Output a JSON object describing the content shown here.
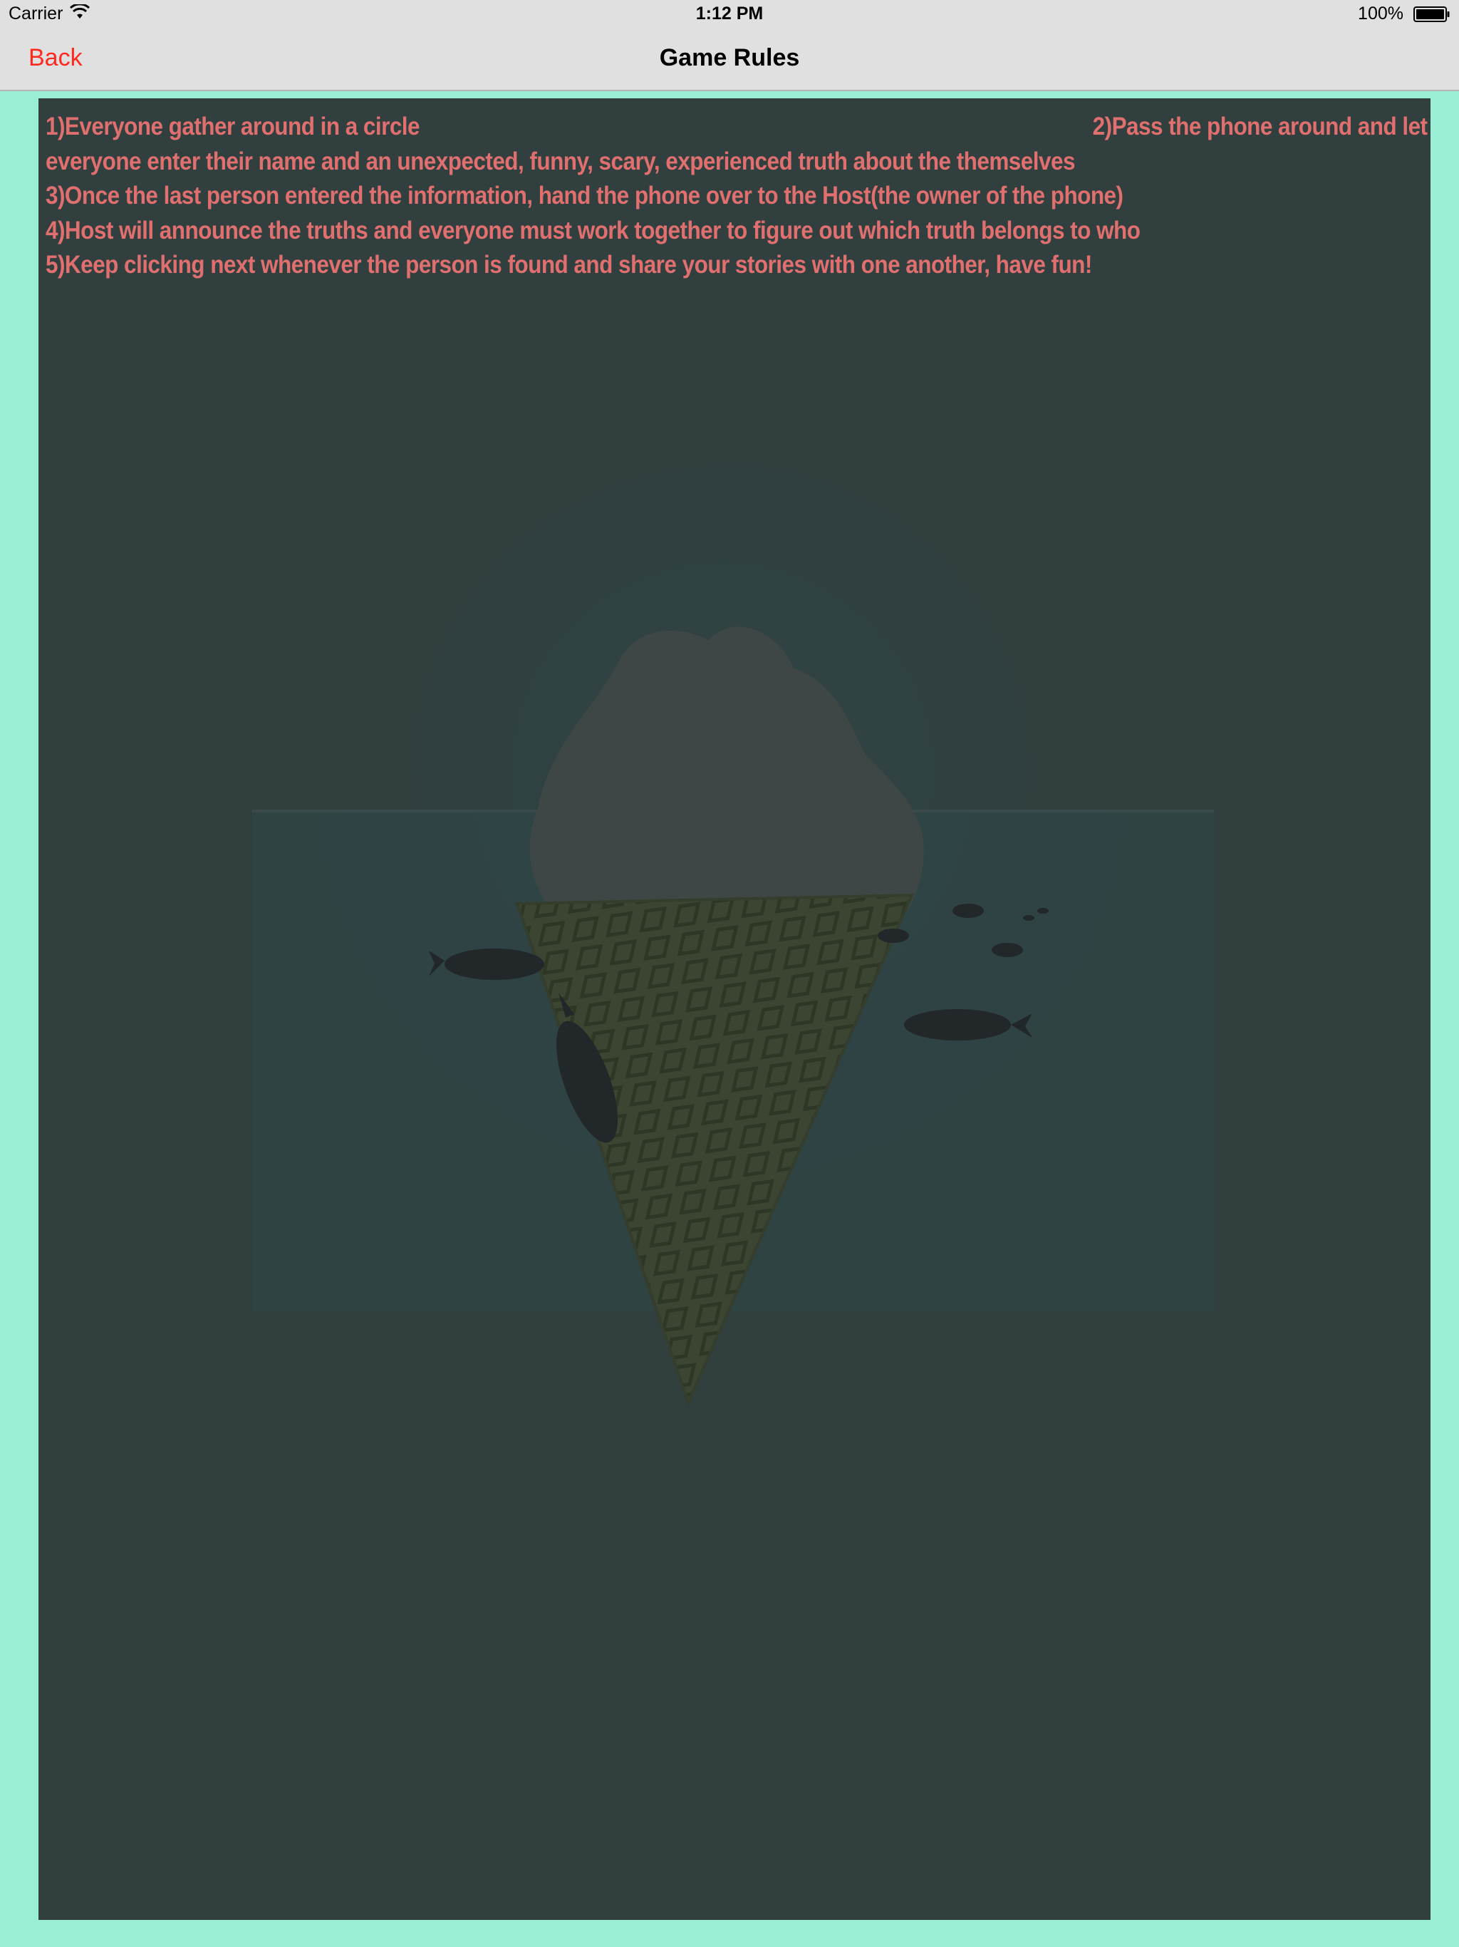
{
  "status_bar": {
    "carrier": "Carrier",
    "time": "1:12 PM",
    "battery_percent": "100%",
    "icons": [
      "wifi-icon",
      "battery-icon"
    ]
  },
  "nav_bar": {
    "back_label": "Back",
    "title": "Game Rules"
  },
  "rules": {
    "line1_left": "1)Everyone gather around in a circle",
    "line1_right": "2)Pass the phone around and let",
    "line2": "everyone enter their name and an unexpected, funny, scary, experienced truth about the themselves",
    "line3": "3)Once the last person entered the information, hand the phone over to the Host(the owner of the phone)",
    "line4": "4)Host will announce the truths and everyone must work together to figure out which truth belongs to who",
    "line5": "5)Keep clicking next whenever the person is found and share your stories with one another, have fun!"
  },
  "colors": {
    "background": "#9beed6",
    "panel": "#313f3e",
    "rule_text": "#e06f6f",
    "back_button": "#ff2a1f",
    "bar": "#e0e0e0"
  }
}
